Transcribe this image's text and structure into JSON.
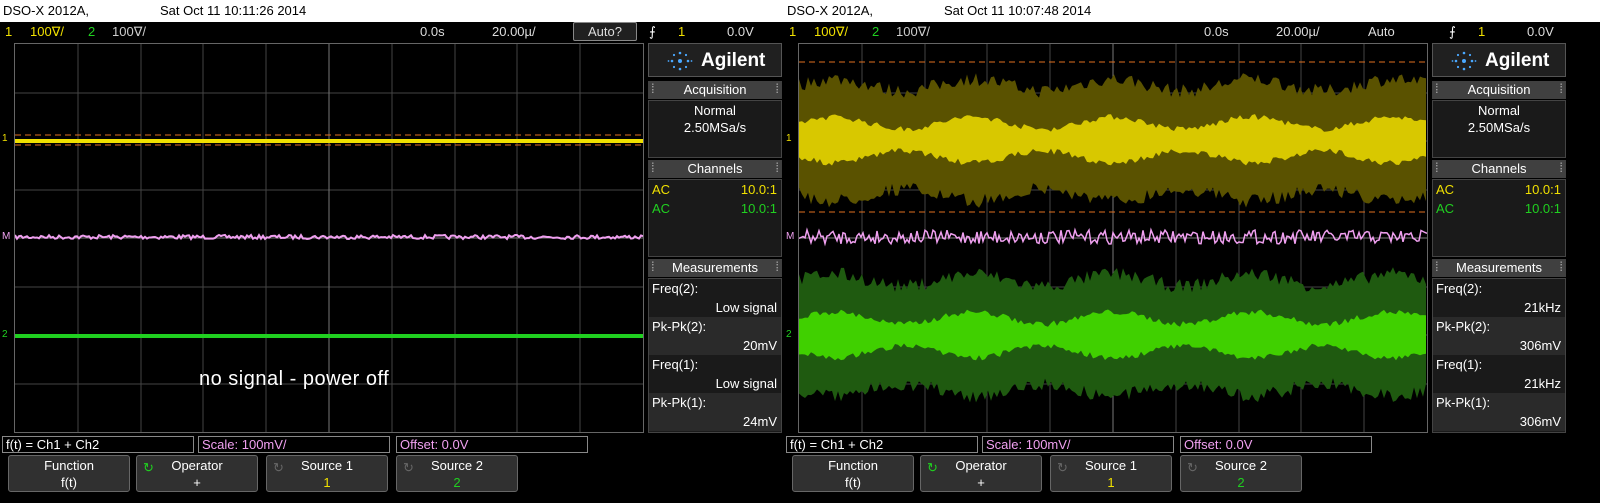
{
  "scopes": [
    {
      "title_model": "DSO-X 2012A,",
      "title_date": "Sat Oct 11 10:11:26 2014",
      "ch1_num": "1",
      "ch1_scale": "100∇/",
      "ch2_num": "2",
      "ch2_scale": "100∇/",
      "delay": "0.0s",
      "timebase": "20.00µ/",
      "trigger_mode": "Auto?",
      "trigger_ch": "1",
      "trigger_level": "0.0V",
      "logo": "Agilent",
      "acquisition_header": "Acquisition",
      "acq_mode": "Normal",
      "acq_rate": "2.50MSa/s",
      "channels_header": "Channels",
      "ch1_coupling": "AC",
      "ch1_probe": "10.0:1",
      "ch2_coupling": "AC",
      "ch2_probe": "10.0:1",
      "measurements_header": "Measurements",
      "meas": [
        {
          "label": "Freq(2):",
          "value": "Low signal"
        },
        {
          "label": "Pk-Pk(2):",
          "value": "20mV"
        },
        {
          "label": "Freq(1):",
          "value": "Low signal"
        },
        {
          "label": "Pk-Pk(1):",
          "value": "24mV"
        }
      ],
      "annotation": "no signal - power off",
      "func_label": "f(t) = Ch1 + Ch2",
      "scale_label": "Scale: 100mV/",
      "offset_label": "Offset: 0.0V",
      "softkeys": [
        {
          "title": "Function",
          "value": "f(t)"
        },
        {
          "title": "Operator",
          "value": "+"
        },
        {
          "title": "Source 1",
          "value": "1"
        },
        {
          "title": "Source 2",
          "value": "2"
        }
      ],
      "marker_ch1": "1",
      "marker_math": "M",
      "marker_ch2": "2"
    },
    {
      "title_model": "DSO-X 2012A,",
      "title_date": "Sat Oct 11 10:07:48 2014",
      "ch1_num": "1",
      "ch1_scale": "100∇/",
      "ch2_num": "2",
      "ch2_scale": "100∇/",
      "delay": "0.0s",
      "timebase": "20.00µ/",
      "trigger_mode": "Auto",
      "trigger_ch": "1",
      "trigger_level": "0.0V",
      "logo": "Agilent",
      "acquisition_header": "Acquisition",
      "acq_mode": "Normal",
      "acq_rate": "2.50MSa/s",
      "channels_header": "Channels",
      "ch1_coupling": "AC",
      "ch1_probe": "10.0:1",
      "ch2_coupling": "AC",
      "ch2_probe": "10.0:1",
      "measurements_header": "Measurements",
      "meas": [
        {
          "label": "Freq(2):",
          "value": "21kHz"
        },
        {
          "label": "Pk-Pk(2):",
          "value": "306mV"
        },
        {
          "label": "Freq(1):",
          "value": "21kHz"
        },
        {
          "label": "Pk-Pk(1):",
          "value": "306mV"
        }
      ],
      "func_label": "f(t) = Ch1 + Ch2",
      "scale_label": "Scale: 100mV/",
      "offset_label": "Offset: 0.0V",
      "softkeys": [
        {
          "title": "Function",
          "value": "f(t)"
        },
        {
          "title": "Operator",
          "value": "+"
        },
        {
          "title": "Source 1",
          "value": "1"
        },
        {
          "title": "Source 2",
          "value": "2"
        }
      ],
      "marker_ch1": "1",
      "marker_math": "M",
      "marker_ch2": "2"
    }
  ],
  "colors": {
    "ch1": "#f0e000",
    "ch2": "#20d020",
    "math": "#f0a0f0",
    "trigger_line": "#e07020"
  }
}
